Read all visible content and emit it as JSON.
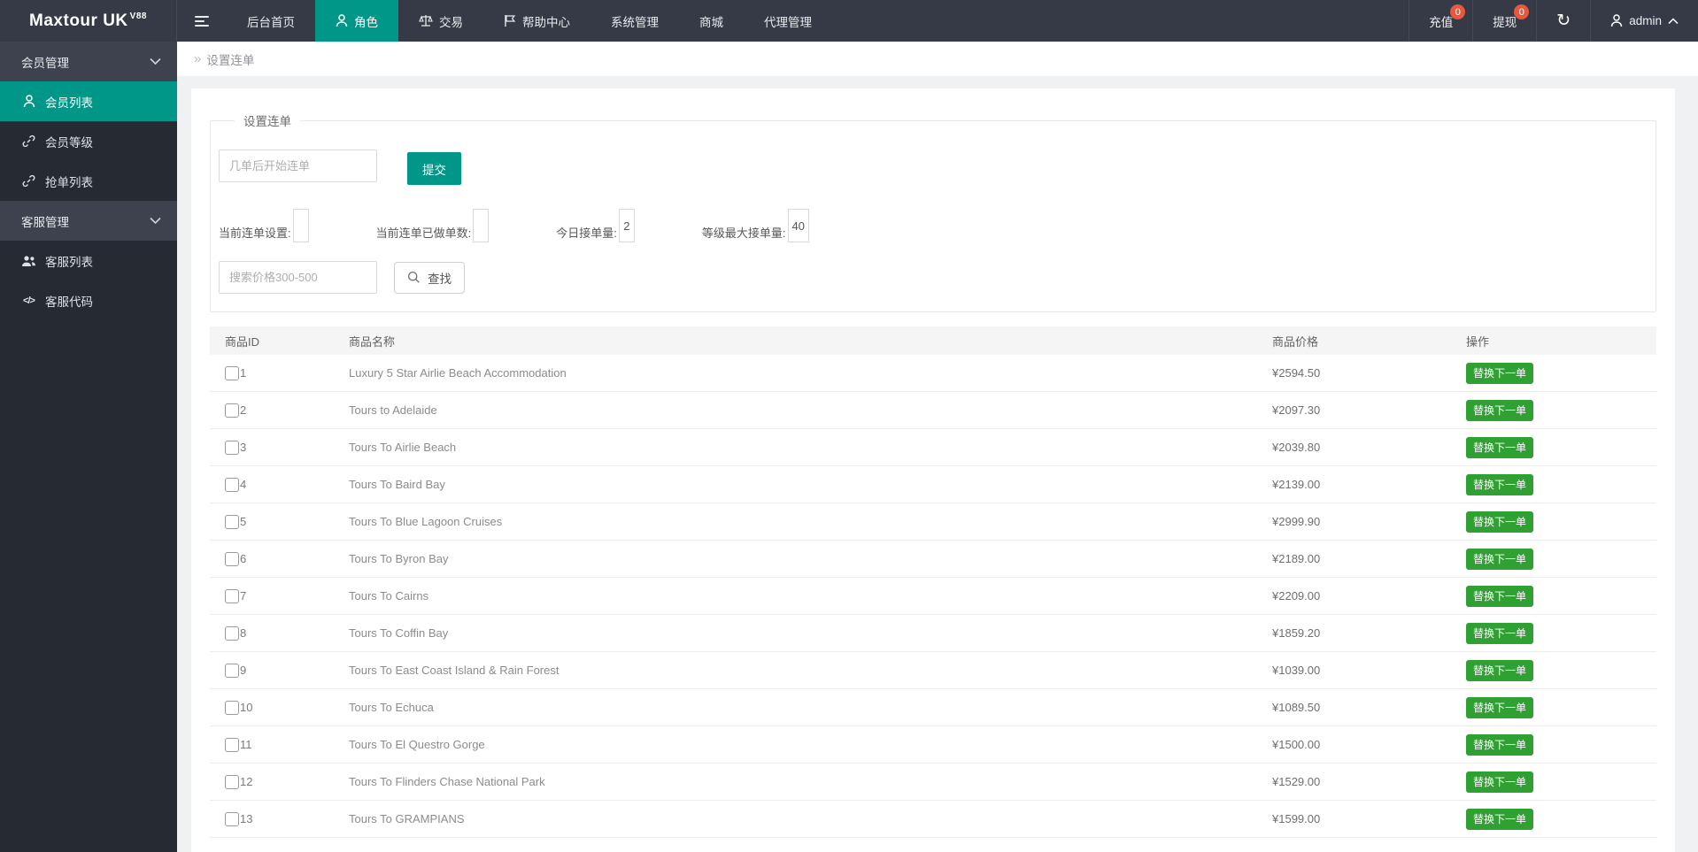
{
  "colors": {
    "teal": "#009688",
    "green": "#2fa032",
    "badge": "#e8573e"
  },
  "navbar": {
    "logo": "Maxtour UK",
    "logo_version": "V88",
    "items": [
      {
        "label": "后台首页"
      },
      {
        "label": "角色"
      },
      {
        "label": "交易"
      },
      {
        "label": "帮助中心"
      },
      {
        "label": "系统管理"
      },
      {
        "label": "商城"
      },
      {
        "label": "代理管理"
      }
    ],
    "recharge_label": "充值",
    "recharge_badge": "0",
    "withdraw_label": "提现",
    "withdraw_badge": "0",
    "username": "admin"
  },
  "sidebar": {
    "sections": [
      {
        "title": "会员管理",
        "items": [
          {
            "label": "会员列表"
          },
          {
            "label": "会员等级"
          },
          {
            "label": "抢单列表"
          }
        ]
      },
      {
        "title": "客服管理",
        "items": [
          {
            "label": "客服列表"
          },
          {
            "label": "客服代码"
          }
        ]
      }
    ]
  },
  "breadcrumb": "设置连单",
  "panel": {
    "legend": "设置连单",
    "chain_input_placeholder": "几单后开始连单",
    "submit_label": "提交",
    "stats": [
      {
        "label": "当前连单设置:",
        "value": ""
      },
      {
        "label": "当前连单已做单数:",
        "value": ""
      },
      {
        "label": "今日接单量:",
        "value": "2"
      },
      {
        "label": "等级最大接单量:",
        "value": "40"
      }
    ],
    "search_placeholder": "搜索价格300-500",
    "search_label": "查找"
  },
  "table": {
    "columns": [
      "商品ID",
      "商品名称",
      "商品价格",
      "操作"
    ],
    "action_label": "替换下一单",
    "rows": [
      {
        "id": "1",
        "name": "Luxury 5 Star Airlie Beach Accommodation",
        "price": "¥2594.50"
      },
      {
        "id": "2",
        "name": "Tours to Adelaide",
        "price": "¥2097.30"
      },
      {
        "id": "3",
        "name": "Tours To Airlie Beach",
        "price": "¥2039.80"
      },
      {
        "id": "4",
        "name": "Tours To Baird Bay",
        "price": "¥2139.00"
      },
      {
        "id": "5",
        "name": "Tours To Blue Lagoon Cruises",
        "price": "¥2999.90"
      },
      {
        "id": "6",
        "name": "Tours To Byron Bay",
        "price": "¥2189.00"
      },
      {
        "id": "7",
        "name": "Tours To Cairns",
        "price": "¥2209.00"
      },
      {
        "id": "8",
        "name": "Tours To Coffin Bay",
        "price": "¥1859.20"
      },
      {
        "id": "9",
        "name": "Tours To East Coast Island & Rain Forest",
        "price": "¥1039.00"
      },
      {
        "id": "10",
        "name": "Tours To Echuca",
        "price": "¥1089.50"
      },
      {
        "id": "11",
        "name": "Tours To El Questro Gorge",
        "price": "¥1500.00"
      },
      {
        "id": "12",
        "name": "Tours To Flinders Chase National Park",
        "price": "¥1529.00"
      },
      {
        "id": "13",
        "name": "Tours To GRAMPIANS",
        "price": "¥1599.00"
      }
    ]
  }
}
